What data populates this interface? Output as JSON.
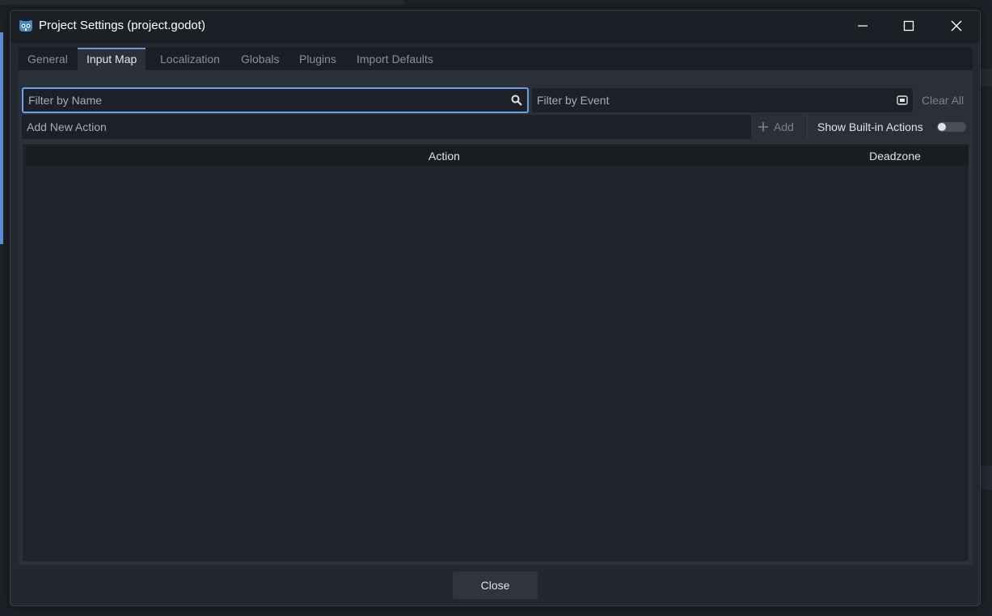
{
  "window": {
    "title": "Project Settings (project.godot)",
    "app_icon": "godot-logo-icon",
    "controls": [
      "minimize-icon",
      "maximize-icon",
      "close-icon"
    ]
  },
  "tabs": [
    {
      "label": "General",
      "active": false
    },
    {
      "label": "Input Map",
      "active": true
    },
    {
      "label": "Localization",
      "active": false
    },
    {
      "label": "Globals",
      "active": false
    },
    {
      "label": "Plugins",
      "active": false
    },
    {
      "label": "Import Defaults",
      "active": false
    }
  ],
  "filters": {
    "name_placeholder": "Filter by Name",
    "name_value": "",
    "name_icon": "search-icon",
    "event_placeholder": "Filter by Event",
    "event_value": "",
    "event_icon": "keyboard-icon",
    "clear_all": "Clear All"
  },
  "actions": {
    "new_action_placeholder": "Add New Action",
    "new_action_value": "",
    "add_label": "Add",
    "add_icon": "plus-icon",
    "show_builtin_label": "Show Built-in Actions",
    "show_builtin": false
  },
  "table": {
    "columns": [
      "Action",
      "Deadzone"
    ],
    "rows": []
  },
  "footer": {
    "close_label": "Close"
  },
  "colors": {
    "accent": "#6ba1e8",
    "background": "#232830",
    "panel": "#2b3038"
  }
}
